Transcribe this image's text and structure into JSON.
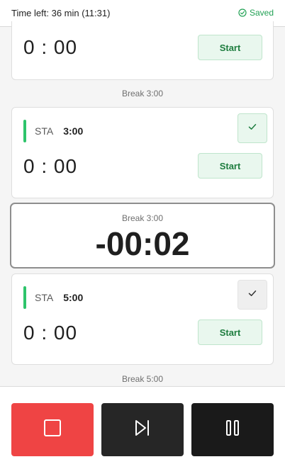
{
  "header": {
    "time_left": "Time left: 36 min (11:31)",
    "saved_label": "Saved",
    "saved_icon": "check-circle-icon",
    "saved_color": "#21a154"
  },
  "segments": [
    {
      "timer": "0 : 00",
      "start_label": "Start"
    },
    {
      "type": "STA",
      "duration": "3:00",
      "timer": "0 : 00",
      "start_label": "Start",
      "checked": true
    },
    {
      "type": "STA",
      "duration": "5:00",
      "timer": "0 : 00",
      "start_label": "Start",
      "checked": false
    }
  ],
  "breaks": [
    {
      "label": "Break 3:00"
    },
    {
      "label": "Break 3:00",
      "countdown": "-00:02",
      "active": true
    },
    {
      "label": "Break 5:00"
    }
  ],
  "controls": {
    "stop_icon": "stop-icon",
    "skip_icon": "skip-next-icon",
    "pause_icon": "pause-icon",
    "stop_color": "#ef4444",
    "skip_color": "#262626",
    "pause_color": "#1a1a1a"
  },
  "colors": {
    "accent_green": "#2ec46b",
    "start_bg": "#e9f7ee"
  }
}
